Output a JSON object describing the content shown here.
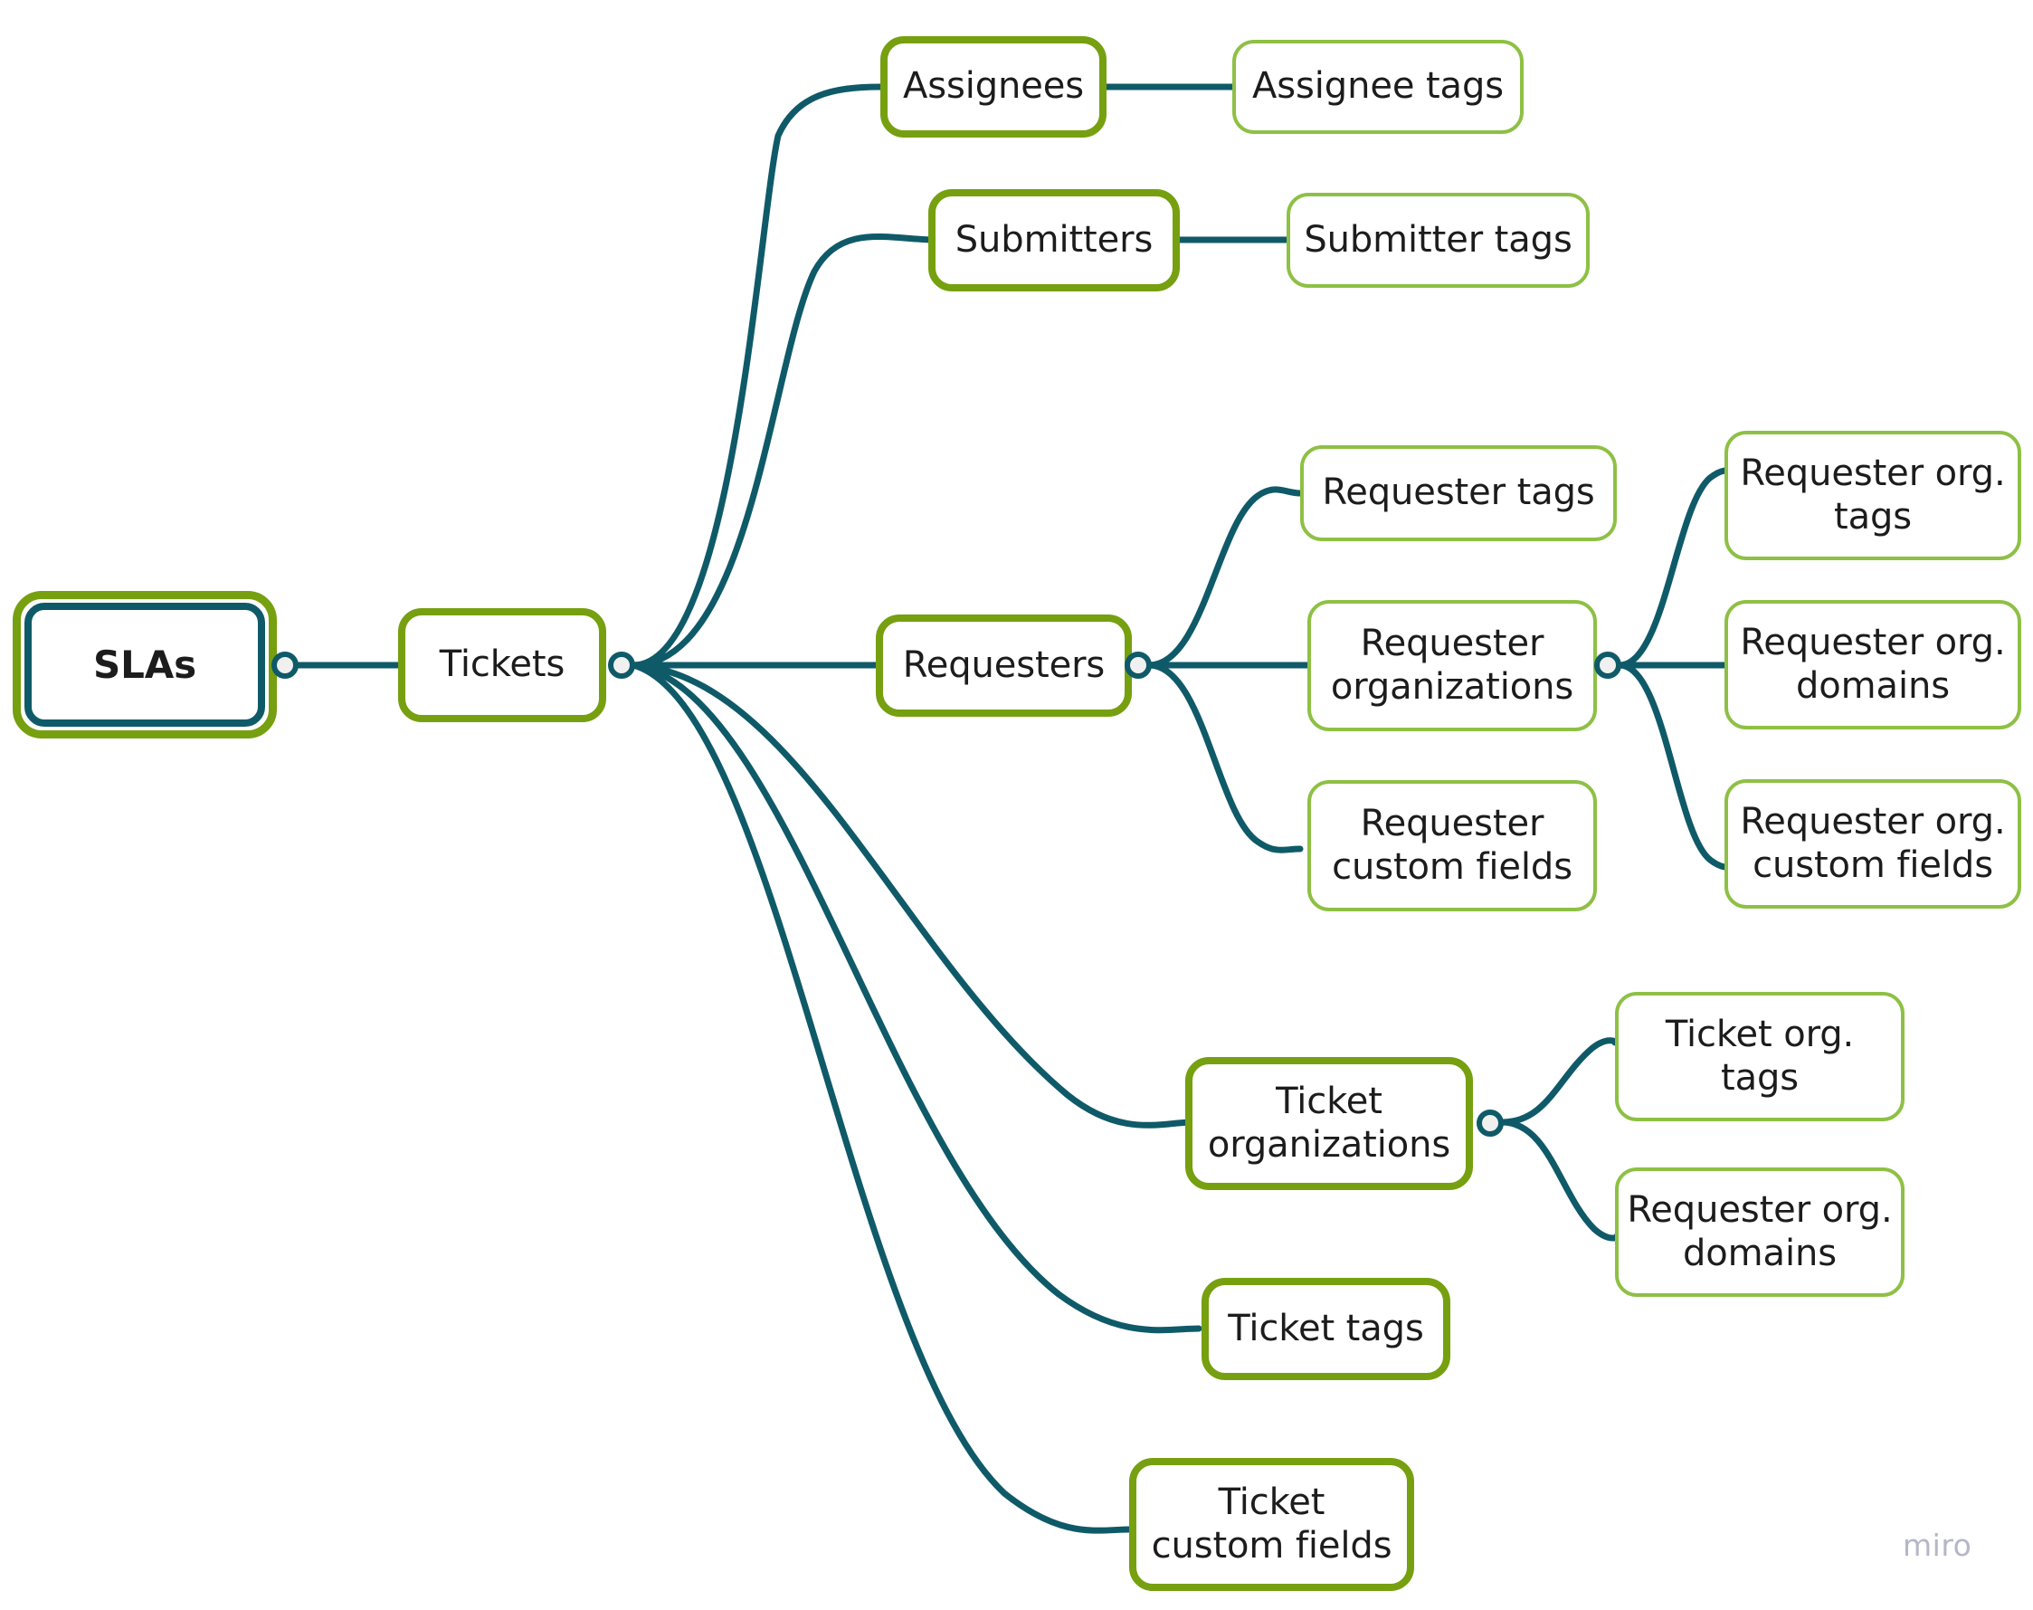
{
  "diagram": {
    "title": "SLAs",
    "type": "mind-map",
    "colors": {
      "edge": "#0f5a68",
      "primary_border": "#76a010",
      "secondary_border": "#8ec045",
      "root_outer_border": "#76a010",
      "root_inner_border": "#0f5a68",
      "node_fill": "#ffffff",
      "knob_fill": "#f0f0f0",
      "text": "#1c1c1c",
      "background": "#ffffff",
      "watermark": "#b6b6c8"
    }
  },
  "nodes": {
    "root": {
      "label": "SLAs",
      "level": 0
    },
    "tickets": {
      "label": "Tickets",
      "level": 1
    },
    "assignees": {
      "label": "Assignees",
      "level": 2
    },
    "assignee_tags": {
      "label": "Assignee tags",
      "level": 3
    },
    "submitters": {
      "label": "Submitters",
      "level": 2
    },
    "submitter_tags": {
      "label": "Submitter tags",
      "level": 3
    },
    "requesters": {
      "label": "Requesters",
      "level": 2
    },
    "requester_tags": {
      "label": "Requester tags",
      "level": 3
    },
    "requester_organizations": {
      "label": "Requester\norganizations",
      "level": 3
    },
    "requester_custom_fields": {
      "label": "Requester\ncustom fields",
      "level": 3
    },
    "requester_org_tags": {
      "label": "Requester org.\ntags",
      "level": 4
    },
    "requester_org_domains": {
      "label": "Requester org.\ndomains",
      "level": 4
    },
    "requester_org_custom_fields": {
      "label": "Requester org.\ncustom fields",
      "level": 4
    },
    "ticket_organizations": {
      "label": "Ticket\norganizations",
      "level": 2
    },
    "ticket_org_tags": {
      "label": "Ticket org.\ntags",
      "level": 3
    },
    "ticket_requester_org_domains": {
      "label": "Requester org.\ndomains",
      "level": 3
    },
    "ticket_tags": {
      "label": "Ticket tags",
      "level": 2
    },
    "ticket_custom_fields": {
      "label": "Ticket\ncustom fields",
      "level": 2
    }
  },
  "edges": [
    {
      "from": "root",
      "to": "tickets"
    },
    {
      "from": "tickets",
      "to": "assignees"
    },
    {
      "from": "assignees",
      "to": "assignee_tags"
    },
    {
      "from": "tickets",
      "to": "submitters"
    },
    {
      "from": "submitters",
      "to": "submitter_tags"
    },
    {
      "from": "tickets",
      "to": "requesters"
    },
    {
      "from": "requesters",
      "to": "requester_tags"
    },
    {
      "from": "requesters",
      "to": "requester_organizations"
    },
    {
      "from": "requesters",
      "to": "requester_custom_fields"
    },
    {
      "from": "requester_organizations",
      "to": "requester_org_tags"
    },
    {
      "from": "requester_organizations",
      "to": "requester_org_domains"
    },
    {
      "from": "requester_organizations",
      "to": "requester_org_custom_fields"
    },
    {
      "from": "tickets",
      "to": "ticket_organizations"
    },
    {
      "from": "ticket_organizations",
      "to": "ticket_org_tags"
    },
    {
      "from": "ticket_organizations",
      "to": "ticket_requester_org_domains"
    },
    {
      "from": "tickets",
      "to": "ticket_tags"
    },
    {
      "from": "tickets",
      "to": "ticket_custom_fields"
    }
  ],
  "watermark": {
    "label": "miro"
  }
}
